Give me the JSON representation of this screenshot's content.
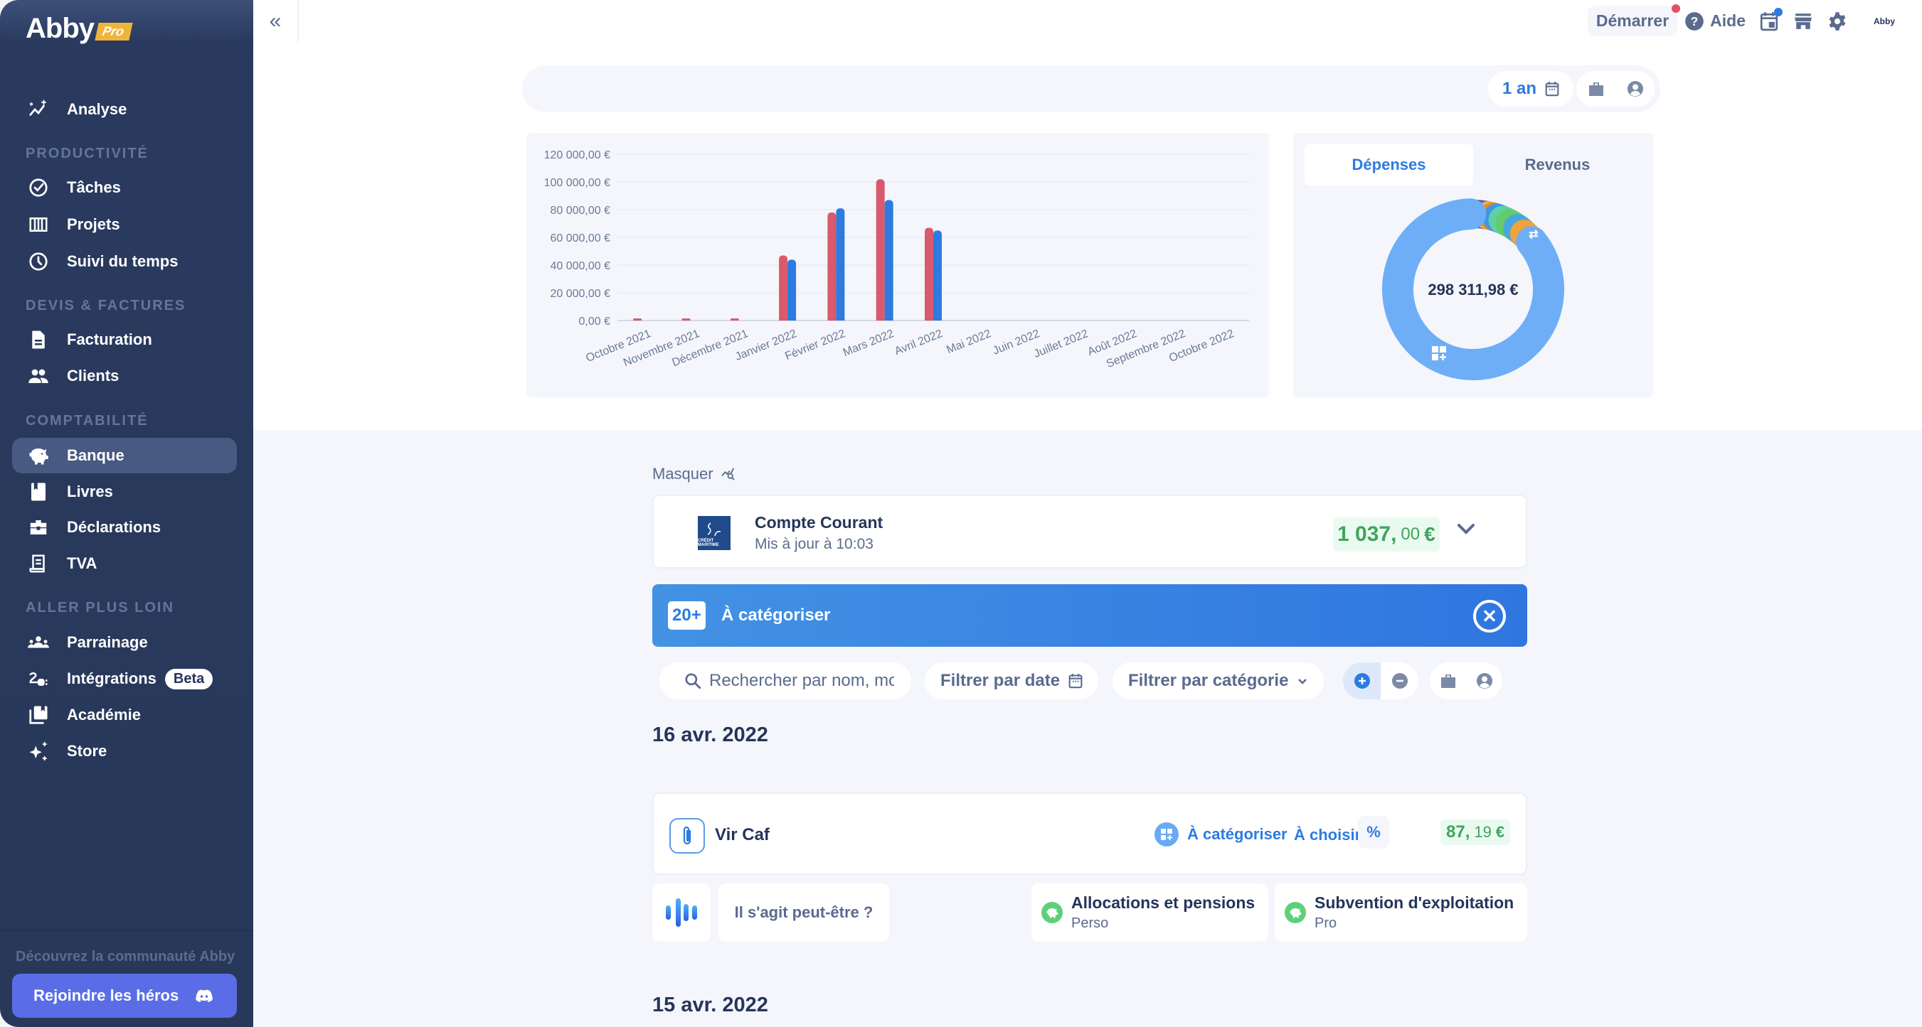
{
  "brand": {
    "name": "Abby",
    "badge": "Pro"
  },
  "sidebar": {
    "top_item": {
      "label": "Analyse",
      "icon": "analytics-sparkle-icon"
    },
    "sections": [
      {
        "title": "PRODUCTIVITÉ",
        "items": [
          {
            "label": "Tâches",
            "icon": "check-circle-icon"
          },
          {
            "label": "Projets",
            "icon": "kanban-icon"
          },
          {
            "label": "Suivi du temps",
            "icon": "clock-icon"
          }
        ]
      },
      {
        "title": "DEVIS & FACTURES",
        "items": [
          {
            "label": "Facturation",
            "icon": "document-icon"
          },
          {
            "label": "Clients",
            "icon": "users-icon"
          }
        ]
      },
      {
        "title": "COMPTABILITÉ",
        "items": [
          {
            "label": "Banque",
            "icon": "piggy-bank-icon",
            "active": true
          },
          {
            "label": "Livres",
            "icon": "book-icon"
          },
          {
            "label": "Déclarations",
            "icon": "toolbox-icon"
          },
          {
            "label": "TVA",
            "icon": "receipt-icon"
          }
        ]
      },
      {
        "title": "ALLER PLUS LOIN",
        "items": [
          {
            "label": "Parrainage",
            "icon": "group-icon"
          },
          {
            "label": "Intégrations",
            "icon": "plug-icon",
            "badge": "Beta"
          },
          {
            "label": "Académie",
            "icon": "library-icon"
          },
          {
            "label": "Store",
            "icon": "sparkles-icon"
          }
        ]
      }
    ],
    "community_text": "Découvrez la communauté Abby",
    "join_button": "Rejoindre les héros"
  },
  "topbar": {
    "collapse_icon": "«",
    "demarrer": "Démarrer",
    "aide": "Aide",
    "avatar_text": "Abby"
  },
  "overview": {
    "period": "1 an",
    "donut": {
      "tabs": [
        "Dépenses",
        "Revenus"
      ],
      "active_tab": "Dépenses",
      "total": "298 311,98 €"
    }
  },
  "chart_data": [
    {
      "type": "bar",
      "title": "",
      "xlabel": "",
      "ylabel": "",
      "categories": [
        "Octobre 2021",
        "Novembre 2021",
        "Décembre 2021",
        "Janvier 2022",
        "Février 2022",
        "Mars 2022",
        "Avril 2022",
        "Mai 2022",
        "Juin 2022",
        "Juillet 2022",
        "Août 2022",
        "Septembre 2022",
        "Octobre 2022"
      ],
      "series": [
        {
          "name": "Dépenses",
          "color": "#d95a6c",
          "values": [
            300,
            1500,
            700,
            47000,
            78000,
            102000,
            67000,
            0,
            0,
            0,
            0,
            0,
            0
          ]
        },
        {
          "name": "Revenus",
          "color": "#2d7be0",
          "values": [
            0,
            0,
            0,
            44000,
            81000,
            87000,
            65000,
            0,
            0,
            0,
            0,
            0,
            0
          ]
        }
      ],
      "yticks": [
        "0,00 €",
        "20 000,00 €",
        "40 000,00 €",
        "60 000,00 €",
        "80 000,00 €",
        "100 000,00 €",
        "120 000,00 €"
      ],
      "ylim": [
        0,
        120000
      ],
      "grid": true,
      "legend": "none"
    },
    {
      "type": "pie",
      "title": "Dépenses",
      "center_label": "298 311,98 €",
      "slices": [
        {
          "name": "À catégoriser",
          "color": "#6eaef7",
          "value": 82
        },
        {
          "name": "cat-purple",
          "color": "#a259e6",
          "value": 0.8
        },
        {
          "name": "cat-teal-dark",
          "color": "#2c6f8c",
          "value": 0.8
        },
        {
          "name": "cat-maroon",
          "color": "#9c3a4e",
          "value": 0.8
        },
        {
          "name": "cat-blue",
          "color": "#3b6ef0",
          "value": 0.8
        },
        {
          "name": "cat-yellow",
          "color": "#f2b640",
          "value": 0.9
        },
        {
          "name": "cat-orange",
          "color": "#e58a34",
          "value": 0.9
        },
        {
          "name": "cat-lightblue",
          "color": "#3f95e8",
          "value": 1.2
        },
        {
          "name": "cat-mint",
          "color": "#5fcfa6",
          "value": 1.6
        },
        {
          "name": "cat-green",
          "color": "#63cc6a",
          "value": 1.8
        },
        {
          "name": "cat-sky",
          "color": "#48a6de",
          "value": 1.8
        },
        {
          "name": "Transferts",
          "color": "#eea33c",
          "value": 2.2
        }
      ]
    }
  ],
  "bank": {
    "hide_label": "Masquer",
    "account": {
      "bank_logo_text": "CRÉDIT MARITIME",
      "name": "Compte Courant",
      "updated": "Mis à jour à 10:03",
      "balance_int": "1 037,",
      "balance_dec": "00",
      "currency": "€"
    },
    "banner": {
      "count": "20+",
      "label": "À catégoriser"
    },
    "filters": {
      "search_placeholder": "Rechercher par nom, montant...",
      "date_filter": "Filtrer par date",
      "category_filter": "Filtrer par catégorie"
    },
    "groups": [
      {
        "date": "16 avr. 2022",
        "transactions": [
          {
            "name": "Vir Caf",
            "category": "À catégoriser",
            "choose": "À choisir",
            "percent": "%",
            "amount_int": "87,",
            "amount_dec": "19",
            "currency": "€",
            "suggestion_prompt": "Il s'agit peut-être ?",
            "suggestions": [
              {
                "title": "Allocations et pensions",
                "subtitle": "Perso"
              },
              {
                "title": "Subvention d'exploitation",
                "subtitle": "Pro"
              }
            ]
          }
        ]
      },
      {
        "date": "15 avr. 2022",
        "transactions": []
      }
    ]
  }
}
